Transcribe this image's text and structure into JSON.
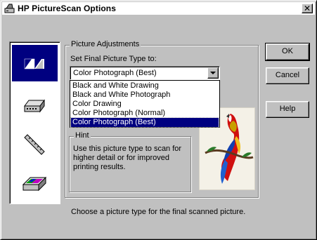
{
  "window": {
    "title": "HP PictureScan Options",
    "close_glyph": "✕"
  },
  "icon_panel": {
    "items": [
      {
        "name": "picture-type-icon",
        "selected": true
      },
      {
        "name": "scanner-icon",
        "selected": false
      },
      {
        "name": "ruler-icon",
        "selected": false
      },
      {
        "name": "flatbed-scanner-icon",
        "selected": false
      }
    ]
  },
  "adjustments": {
    "group_label": "Picture Adjustments",
    "field_label": "Set Final Picture Type to:",
    "selected_value": "Color Photograph (Best)",
    "options": [
      "Black and White Drawing",
      "Black and White Photograph",
      "Color Drawing",
      "Color Photograph (Normal)",
      "Color Photograph (Best)"
    ],
    "selected_index": 4
  },
  "hint": {
    "group_label": "Hint",
    "text": "Use this picture type to scan for higher detail or for improved printing results."
  },
  "preview": {
    "icon": "parrot-preview-image"
  },
  "buttons": {
    "ok": "OK",
    "cancel": "Cancel",
    "help": "Help"
  },
  "status": {
    "text": "Choose a picture type for the final scanned picture."
  },
  "colors": {
    "face": "#c0c0c0",
    "highlight": "#000080",
    "window": "#ffffff"
  }
}
